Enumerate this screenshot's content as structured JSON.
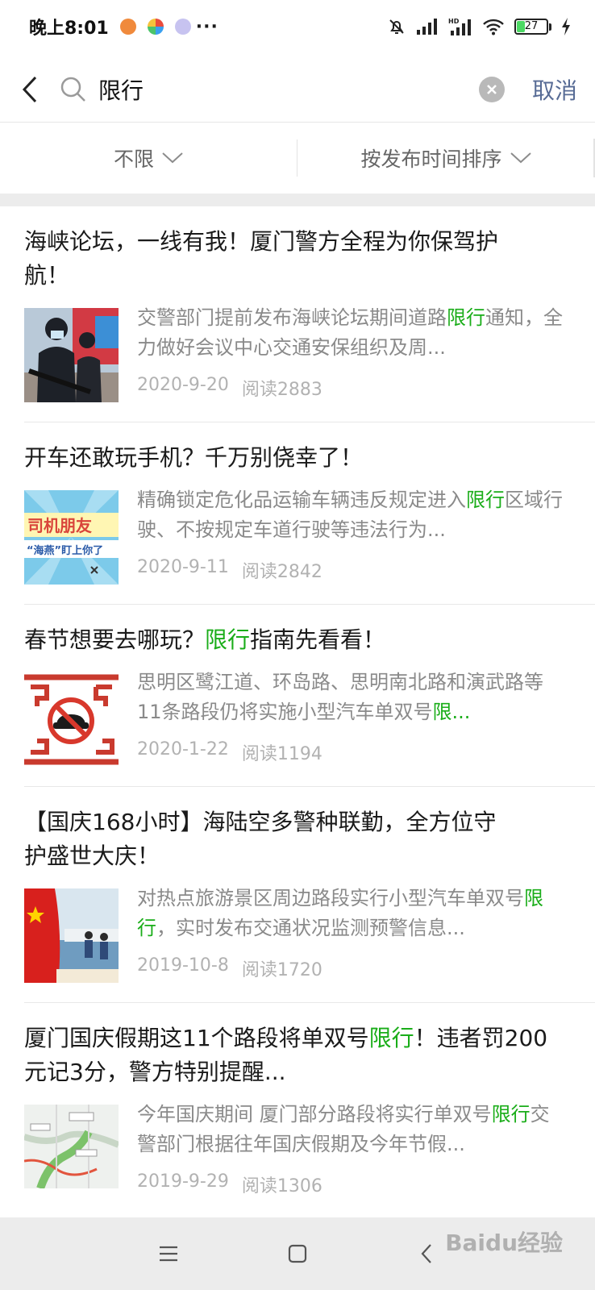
{
  "status": {
    "time": "晚上8:01",
    "more": "···",
    "battery": "27"
  },
  "search": {
    "query": "限行",
    "cancel_label": "取消"
  },
  "filters": {
    "range_label": "不限",
    "sort_label": "按发布时间排序"
  },
  "results": [
    {
      "title_parts": [
        "海峡论坛，一线有我！厦门警方全程为你保驾护航！"
      ],
      "title_line1": "海峡论坛，一线有我！厦门警方全程为你保驾护",
      "title_line2": "航！",
      "snippet_a": "交警部门提前发布海峡论坛期间道路",
      "snippet_hl": "限行",
      "snippet_b": "通知，全力做好会议中心交通安保组织及周...",
      "date": "2020-9-20",
      "reads": "阅读2883"
    },
    {
      "title_line1": "开车还敢玩手机？千万别侥幸了！",
      "snippet_a": "精确锁定危化品运输车辆违反规定进入",
      "snippet_hl": "限行",
      "snippet_b": "区域行驶、不按规定车道行驶等违法行为...",
      "date": "2020-9-11",
      "reads": "阅读2842",
      "thumb_text1": "司机朋友",
      "thumb_text2": "“海燕”盯上你了"
    },
    {
      "title_a": "春节想要去哪玩？",
      "title_hl": "限行",
      "title_b": "指南先看看！",
      "snippet_a": "思明区鹭江道、环岛路、思明南北路和演武路等11条路段仍将实施小型汽车单双号",
      "snippet_hl": "限...",
      "date": "2020-1-22",
      "reads": "阅读1194"
    },
    {
      "title_line1": "【国庆168小时】海陆空多警种联勤，全方位守",
      "title_line2": "护盛世大庆！",
      "snippet_a": "对热点旅游景区周边路段实行小型汽车单双号",
      "snippet_hl": "限行",
      "snippet_b": "，实时发布交通状况监测预警信息...",
      "date": "2019-10-8",
      "reads": "阅读1720"
    },
    {
      "title_a": "厦门国庆假期这11个路段将单双号",
      "title_hl": "限行",
      "title_b": "！违者罚200元记3分，警方特别提醒...",
      "snippet_a": "今年国庆期间 厦门部分路段将实行单双号",
      "snippet_hl": "限行",
      "snippet_b": "交警部门根据往年国庆假期及今年节假...",
      "date": "2019-9-29",
      "reads": "阅读1306"
    }
  ],
  "watermark": "Baidu经验",
  "colors": {
    "highlight": "#1aad19",
    "cancel": "#576b95",
    "meta": "#b2b2b2",
    "snippet": "#8a8a8a"
  }
}
